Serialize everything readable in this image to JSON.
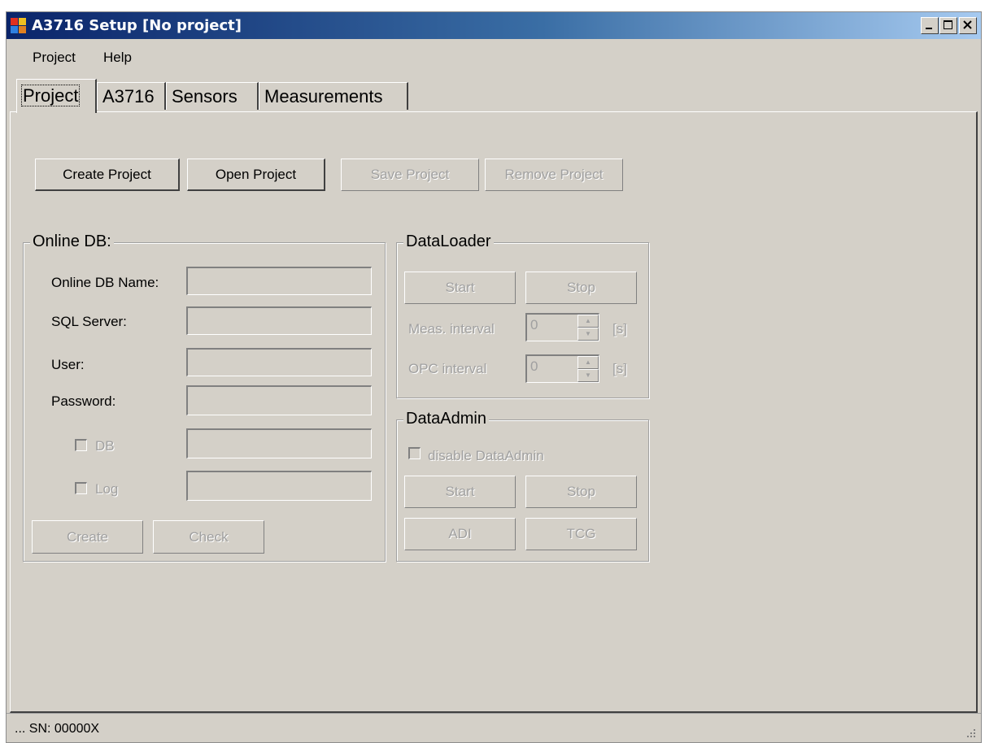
{
  "window": {
    "title": "A3716 Setup [No project]",
    "controls": [
      "minimize",
      "maximize",
      "close"
    ]
  },
  "menu": {
    "items": [
      {
        "label": "Project"
      },
      {
        "label": "Help"
      }
    ]
  },
  "tabs": [
    {
      "label": "Project",
      "active": true
    },
    {
      "label": "A3716",
      "active": false
    },
    {
      "label": "Sensors",
      "active": false
    },
    {
      "label": "Measurements",
      "active": false
    }
  ],
  "project_buttons": {
    "create": {
      "label": "Create Project",
      "enabled": true
    },
    "open": {
      "label": "Open Project",
      "enabled": true
    },
    "save": {
      "label": "Save Project",
      "enabled": false
    },
    "remove": {
      "label": "Remove Project",
      "enabled": false
    }
  },
  "online_db": {
    "title": "Online DB:",
    "name_label": "Online DB Name:",
    "name_value": "",
    "sql_label": "SQL Server:",
    "sql_value": "",
    "user_label": "User:",
    "user_value": "",
    "password_label": "Password:",
    "password_value": "",
    "db_check_label": "DB",
    "db_checked": false,
    "db_value": "",
    "log_check_label": "Log",
    "log_checked": false,
    "log_value": "",
    "create_label": "Create",
    "check_label": "Check"
  },
  "data_loader": {
    "title": "DataLoader",
    "start_label": "Start",
    "stop_label": "Stop",
    "meas_interval_label": "Meas. interval",
    "meas_interval_value": "0",
    "meas_interval_unit": "[s]",
    "opc_interval_label": "OPC interval",
    "opc_interval_value": "0",
    "opc_interval_unit": "[s]"
  },
  "data_admin": {
    "title": "DataAdmin",
    "disable_label": "disable DataAdmin",
    "disable_checked": false,
    "start_label": "Start",
    "stop_label": "Stop",
    "adi_label": "ADI",
    "tcg_label": "TCG"
  },
  "status": {
    "text": "... SN: 00000X"
  },
  "colors": {
    "face": "#d4d0c8",
    "title_start": "#0a246a",
    "title_end": "#a6caf0",
    "disabled_text": "#a0a0a0"
  }
}
